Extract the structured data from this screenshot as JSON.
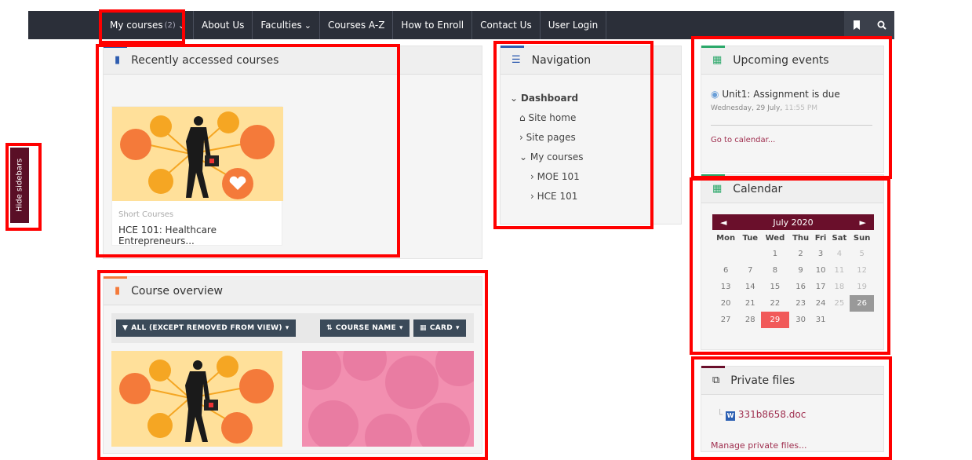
{
  "navbar": {
    "items": [
      {
        "label": "My courses",
        "count": "(2)",
        "caret": "⌄"
      },
      {
        "label": "About Us"
      },
      {
        "label": "Faculties",
        "caret": "⌄"
      },
      {
        "label": "Courses A-Z"
      },
      {
        "label": "How to Enroll"
      },
      {
        "label": "Contact Us"
      },
      {
        "label": "User Login"
      }
    ],
    "icons": [
      "bookmark-icon",
      "search-icon"
    ]
  },
  "sidebar_toggle": {
    "label": "Hide sidebars"
  },
  "recent_courses": {
    "title": "Recently accessed courses",
    "course": {
      "category": "Short Courses",
      "name": "HCE 101: Healthcare Entrepreneurs..."
    }
  },
  "course_overview": {
    "title": "Course overview",
    "filter_label": "ALL (EXCEPT REMOVED FROM VIEW)",
    "sort_label": "COURSE NAME",
    "view_label": "CARD"
  },
  "navigation": {
    "title": "Navigation",
    "dashboard": "Dashboard",
    "site_home": "Site home",
    "site_pages": "Site pages",
    "my_courses": "My courses",
    "courses": [
      "MOE 101",
      "HCE 101"
    ]
  },
  "upcoming_events": {
    "title": "Upcoming events",
    "event_title": "Unit1: Assignment is due",
    "event_date": "Wednesday, 29 July, ",
    "event_time": "11:55 PM",
    "link": "Go to calendar..."
  },
  "calendar": {
    "title": "Calendar",
    "month": "July 2020",
    "prev": "◄",
    "next": "►",
    "days": [
      "Mon",
      "Tue",
      "Wed",
      "Thu",
      "Fri",
      "Sat",
      "Sun"
    ],
    "weeks": [
      [
        "",
        "",
        "1",
        "2",
        "3",
        "4",
        "5"
      ],
      [
        "6",
        "7",
        "8",
        "9",
        "10",
        "11",
        "12"
      ],
      [
        "13",
        "14",
        "15",
        "16",
        "17",
        "18",
        "19"
      ],
      [
        "20",
        "21",
        "22",
        "23",
        "24",
        "25",
        "26"
      ],
      [
        "27",
        "28",
        "29",
        "30",
        "31",
        "",
        ""
      ]
    ],
    "today": "26",
    "event_day": "29"
  },
  "private_files": {
    "title": "Private files",
    "file": "331b8658.doc",
    "manage_link": "Manage private files..."
  },
  "colors": {
    "navbar_bg": "#2b2f39",
    "accent": "#6a0f2b",
    "highlight": "#ff0000",
    "event_day": "#f15a5a"
  }
}
